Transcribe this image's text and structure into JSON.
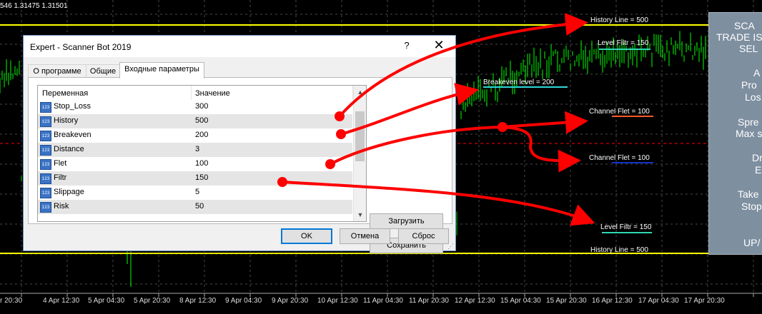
{
  "chart": {
    "price_header": "546 1.31475 1.31501",
    "colors": {
      "background": "#000000",
      "bars": "#00ff00",
      "grid": "#4a4a4a",
      "level_line": "#ffff00",
      "mid_line": "#ff0000",
      "annotation_arrow": "#ff0000"
    },
    "time_axis": [
      "r 20:30",
      "4 Apr 12:30",
      "5 Apr 04:30",
      "5 Apr 20:30",
      "8 Apr 12:30",
      "9 Apr 04:30",
      "9 Apr 20:30",
      "10 Apr 12:30",
      "11 Apr 04:30",
      "11 Apr 20:30",
      "12 Apr 12:30",
      "15 Apr 04:30",
      "15 Apr 20:30",
      "16 Apr 12:30",
      "17 Apr 04:30",
      "17 Apr 20:30"
    ],
    "annotations": {
      "history_top": "History Line = 500",
      "level_filtr_top": "Level Filtr = 150",
      "breakeven": "Breakeven level = 200",
      "channel_flet_1": "Channel Flet = 100",
      "channel_flet_2": "Channel Flet = 100",
      "level_filtr_bottom": "Level Filtr = 150",
      "history_bottom": "History Line = 500"
    }
  },
  "panel": {
    "lines": [
      "SCA",
      "TRADE IS",
      "SEL",
      "A",
      "Pro",
      "Los",
      "Spre",
      "Max s",
      "Dr",
      "E",
      "Take",
      "Stop",
      "UP/"
    ]
  },
  "dialog": {
    "title": "Expert - Scanner Bot  2019",
    "help_label": "?",
    "close_label": "✕",
    "tabs": [
      "О программе",
      "Общие",
      "Входные параметры"
    ],
    "columns": [
      "Переменная",
      "Значение"
    ],
    "params": [
      {
        "icon": "123",
        "name": "Stop_Loss",
        "value": "300"
      },
      {
        "icon": "123",
        "name": "History",
        "value": "500"
      },
      {
        "icon": "123",
        "name": "Breakeven",
        "value": "200"
      },
      {
        "icon": "123",
        "name": "Distance",
        "value": "3"
      },
      {
        "icon": "123",
        "name": "Flet",
        "value": "100"
      },
      {
        "icon": "123",
        "name": "Filtr",
        "value": "150"
      },
      {
        "icon": "123",
        "name": "Slippage",
        "value": "5"
      },
      {
        "icon": "123",
        "name": "Risk",
        "value": "50"
      }
    ],
    "load_label": "Загрузить",
    "save_label": "Сохранить",
    "ok_label": "OK",
    "cancel_label": "Отмена",
    "reset_label": "Сброс"
  }
}
